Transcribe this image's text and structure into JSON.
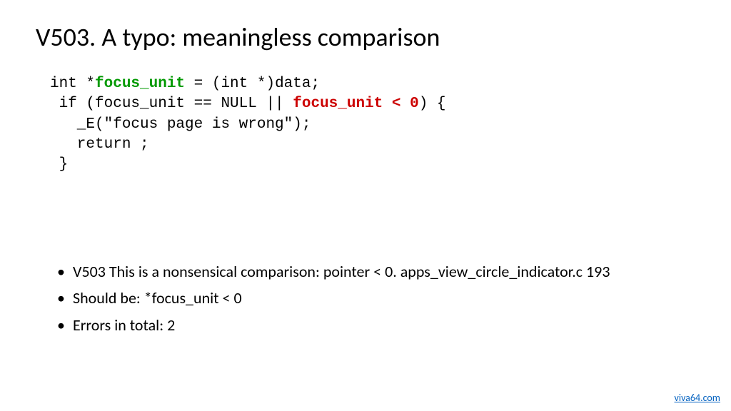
{
  "title": "V503. A typo: meaningless comparison",
  "code": {
    "l1a": "int *",
    "l1b": "focus_unit",
    "l1c": " = (int *)data;",
    "l2a": " if (focus_unit == NULL || ",
    "l2b": "focus_unit < 0",
    "l2c": ") {",
    "l3": "   _E(\"focus page is wrong\");",
    "l4": "   return ;",
    "l5": " }"
  },
  "bullets": {
    "b1": "V503 This is a nonsensical comparison: pointer < 0. apps_view_circle_indicator.c 193",
    "b2": "Should be: *focus_unit < 0",
    "b3": "Errors in total: 2"
  },
  "footer": "viva64.com"
}
